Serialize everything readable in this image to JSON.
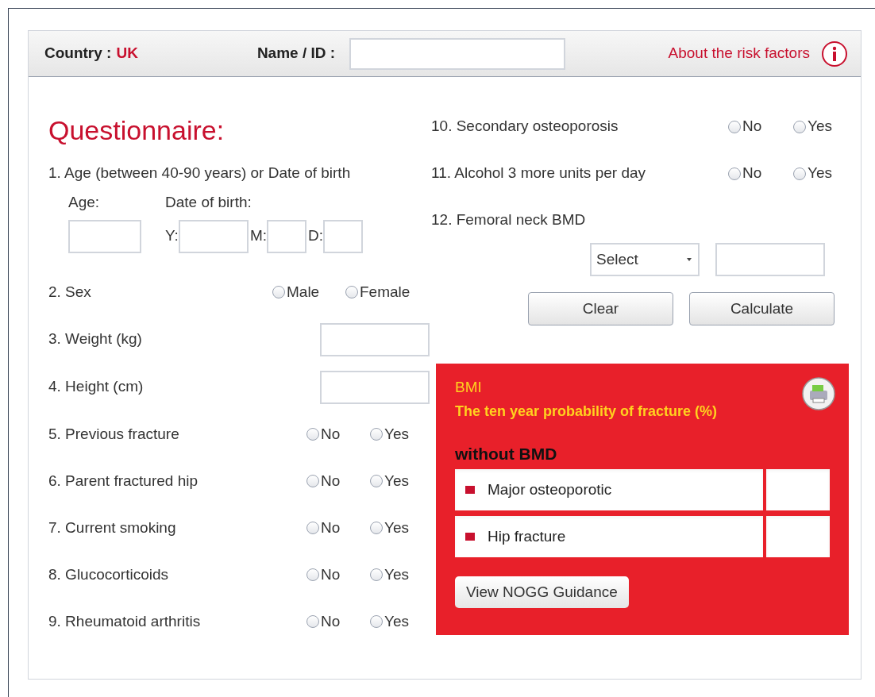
{
  "header": {
    "country_label": "Country :",
    "country_value": "UK",
    "name_label": "Name / ID :",
    "about_link": "About the risk factors"
  },
  "heading": "Questionnaire:",
  "questions_left": [
    {
      "kind": "age",
      "label": "1. Age (between 40-90 years) or Date of birth",
      "age_label": "Age:",
      "dob_label": "Date of birth:",
      "dob_parts": [
        "Y:",
        "M:",
        "D:"
      ]
    },
    {
      "kind": "radio",
      "label": "2. Sex",
      "options": [
        {
          "label": "Male",
          "selected": false
        },
        {
          "label": "Female",
          "selected": false
        }
      ]
    },
    {
      "kind": "input",
      "label": "3. Weight (kg)"
    },
    {
      "kind": "input",
      "label": "4. Height (cm)"
    },
    {
      "kind": "radio",
      "label": "5. Previous fracture",
      "options": [
        {
          "label": "No",
          "selected": false
        },
        {
          "label": "Yes",
          "selected": false
        }
      ]
    },
    {
      "kind": "radio",
      "label": "6. Parent fractured hip",
      "options": [
        {
          "label": "No",
          "selected": false
        },
        {
          "label": "Yes",
          "selected": false
        }
      ]
    },
    {
      "kind": "radio",
      "label": "7. Current smoking",
      "options": [
        {
          "label": "No",
          "selected": false
        },
        {
          "label": "Yes",
          "selected": false
        }
      ]
    },
    {
      "kind": "radio",
      "label": "8. Glucocorticoids",
      "options": [
        {
          "label": "No",
          "selected": false
        },
        {
          "label": "Yes",
          "selected": false
        }
      ]
    },
    {
      "kind": "radio",
      "label": "9. Rheumatoid arthritis",
      "options": [
        {
          "label": "No",
          "selected": false
        },
        {
          "label": "Yes",
          "selected": false
        }
      ]
    }
  ],
  "questions_right": [
    {
      "kind": "radio",
      "label": "10. Secondary osteoporosis",
      "options": [
        {
          "label": "No",
          "selected": false
        },
        {
          "label": "Yes",
          "selected": false
        }
      ]
    },
    {
      "kind": "radio",
      "label": "11. Alcohol 3 more units per day",
      "options": [
        {
          "label": "No",
          "selected": false
        },
        {
          "label": "Yes",
          "selected": false
        }
      ]
    },
    {
      "kind": "bmd",
      "label": "12. Femoral neck BMD",
      "select": "Select"
    }
  ],
  "buttons": [
    "Clear",
    "Calculate"
  ],
  "results": {
    "title": "BMI",
    "subtitle": "The ten year probability of fracture (%)",
    "section": "without BMD",
    "rows": [
      {
        "label": "Major osteoporotic"
      },
      {
        "label": "Hip fracture"
      }
    ],
    "button": "View NOGG Guidance"
  }
}
